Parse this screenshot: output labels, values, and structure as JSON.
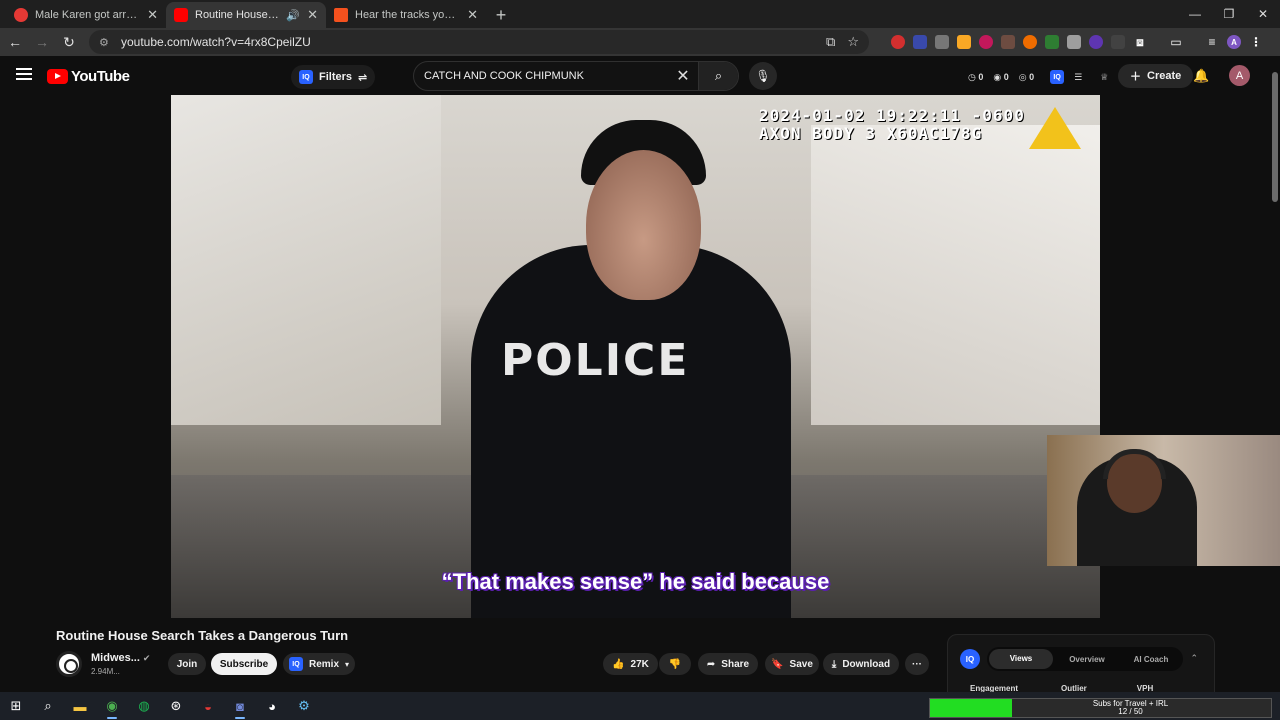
{
  "browser": {
    "tabs": [
      {
        "title": "Male Karen got arrested for th",
        "favicon_color": "#e53935",
        "active": false
      },
      {
        "title": "Routine House Search Take",
        "favicon_color": "#ff0000",
        "active": true
      },
      {
        "title": "Hear the tracks you've liked: on",
        "favicon_color": "#f4511e",
        "active": false
      }
    ],
    "url": "youtube.com/watch?v=4rx8CpeilZU",
    "new_tab_label": "+"
  },
  "youtube": {
    "logo_text": "YouTube",
    "filters_label": "Filters",
    "search_query": "CATCH AND COOK CHIPMUNK",
    "header_stats": [
      "0",
      "0",
      "0"
    ],
    "create_label": "Create",
    "avatar_initial": "A"
  },
  "video": {
    "timestamp_line1": "2024-01-02 19:22:11 -0600",
    "timestamp_line2": "AXON BODY 3 X60AC178G",
    "caption": "“That makes sense” he said because",
    "police_text": "POLICE"
  },
  "meta": {
    "title": "Routine House Search Takes a Dangerous Turn",
    "channel_name": "Midwes...",
    "subscribers": "2.94M...",
    "join_label": "Join",
    "subscribe_label": "Subscribe",
    "remix_label": "Remix",
    "like_count": "27K",
    "share_label": "Share",
    "save_label": "Save",
    "download_label": "Download",
    "more_label": "···"
  },
  "iq_panel": {
    "logo": "IQ",
    "tabs": [
      "Views",
      "Overview",
      "AI Coach"
    ],
    "active_tab": "Views",
    "columns": [
      "Engagement",
      "Outlier",
      "VPH"
    ]
  },
  "stream_goal": {
    "label": "Subs for Travel + IRL",
    "progress_text": "12 / 50",
    "progress": 0.24,
    "fill_color": "#22dd22"
  }
}
